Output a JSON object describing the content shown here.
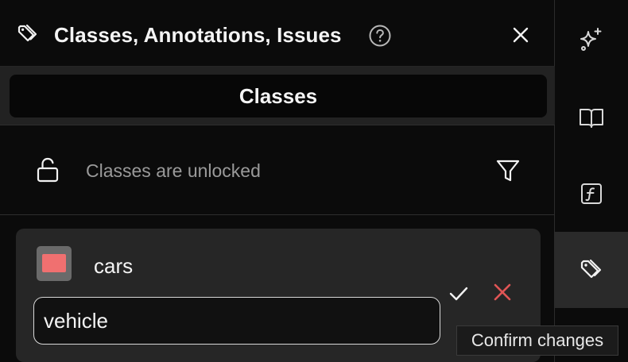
{
  "header": {
    "title": "Classes, Annotations, Issues",
    "icon": "tag-icon",
    "help_icon": "help-circle-icon",
    "close_icon": "close-icon"
  },
  "tabs": {
    "active_label": "Classes"
  },
  "lock": {
    "status_text": "Classes are unlocked",
    "icon": "unlock-icon",
    "filter_icon": "filter-icon"
  },
  "class_card": {
    "name": "cars",
    "color": "#f07070",
    "input_value": "vehicle",
    "confirm_icon": "checkmark-icon",
    "cancel_icon": "x-icon"
  },
  "tooltip": {
    "text": "Confirm changes"
  },
  "rail": {
    "items": [
      {
        "icon": "sparkles-icon",
        "active": false
      },
      {
        "icon": "book-icon",
        "active": false
      },
      {
        "icon": "function-icon",
        "active": false
      },
      {
        "icon": "tag-icon",
        "active": true
      }
    ]
  },
  "colors": {
    "background": "#0b0b0b",
    "tab_bar": "#222222",
    "card": "#262626",
    "cancel_red": "#e05555",
    "swatch": "#f07070"
  }
}
